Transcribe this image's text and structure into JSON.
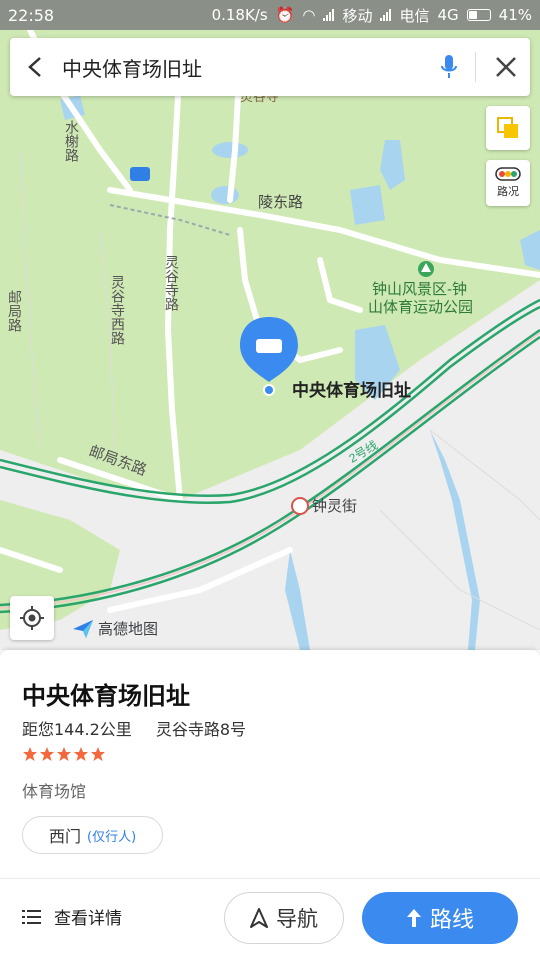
{
  "status_bar": {
    "time": "22:58",
    "speed": "0.18K/s",
    "carrier1": "移动",
    "carrier2": "电信",
    "network": "4G",
    "battery": "41%"
  },
  "search": {
    "query": "中央体育场旧址"
  },
  "map": {
    "traffic_label": "路况",
    "brand": "高德地图",
    "labels": {
      "linggu_temple": "灵谷寺",
      "shuixie_road": "水榭路",
      "lingdong_road": "陵东路",
      "linggusi_road": "灵谷寺路",
      "linggusi_west_road": "灵谷寺西路",
      "youju_road": "邮局路",
      "youju_east_road": "邮局东路",
      "zhongshan_park_line1": "钟山风景区-钟",
      "zhongshan_park_line2": "山体育运动公园",
      "place_marker": "中央体育场旧址",
      "line2": "2号线",
      "zhongling_station": "钟灵街"
    }
  },
  "place": {
    "name": "中央体育场旧址",
    "distance": "距您144.2公里",
    "address": "灵谷寺路8号",
    "rating": 5,
    "category": "体育场馆",
    "entrance": "西门",
    "entrance_note": "(仅行人)"
  },
  "actions": {
    "details": "查看详情",
    "navigate": "导航",
    "route": "路线"
  },
  "colors": {
    "map_green": "#cfe9b4",
    "map_gray": "#eeeeee",
    "water": "#a8d4f0",
    "metro_line": "#2aa56b",
    "accent_blue": "#3b8af0",
    "star": "#f5673d"
  }
}
